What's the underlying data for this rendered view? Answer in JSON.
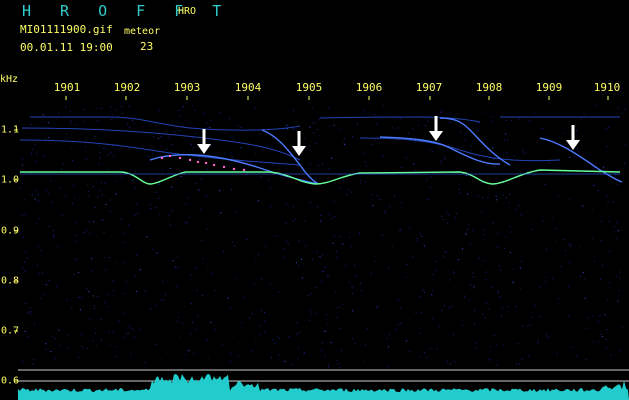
{
  "header": {
    "title": "H R O F F T",
    "mode": "HRO",
    "file_name": "MI01111900.gif",
    "date_time": "00.01.11 19:00",
    "meteor_label": "meteor",
    "meteor_count": "23"
  },
  "axis": {
    "unit": "kHz",
    "minutes": [
      "1901",
      "1902",
      "1903",
      "1904",
      "1905",
      "1906",
      "1907",
      "1908",
      "1909",
      "1910"
    ],
    "frequencies": [
      "1.1",
      "1.0",
      "0.9",
      "0.8",
      "0.7",
      "0.6"
    ]
  },
  "colors": {
    "background": "#000000",
    "label": "#ffff66",
    "title": "#33cccc",
    "trace": "#3366ff",
    "carrier": "#66ff99",
    "level": "#22cccc",
    "arrow": "#ffffff"
  }
}
